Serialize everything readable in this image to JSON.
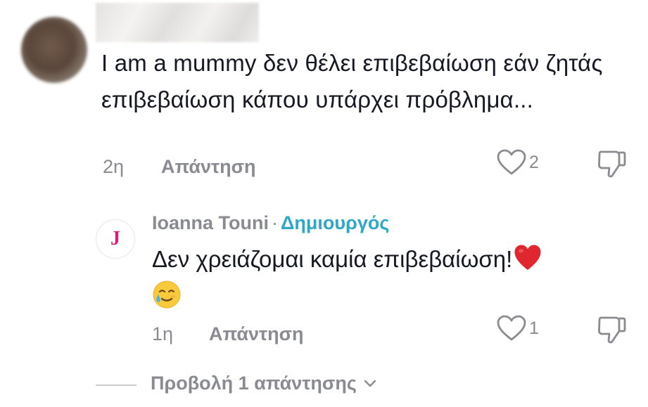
{
  "comment": {
    "text": "I am a mummy δεν θέλει επιβεβαίωση εάν ζητάς επιβεβαίωση κάπου υπάρχει πρόβλημα...",
    "time": "2η",
    "reply_label": "Απάντηση",
    "like_count": "2",
    "icons": {
      "like": "heart-outline-icon",
      "dislike": "thumbs-down-icon"
    }
  },
  "reply": {
    "avatar_letter": "J",
    "author": "Ioanna Touni",
    "separator": "·",
    "badge": "Δημιουργός",
    "text": "Δεν χρειάζομαι καμία επιβεβαίωση!",
    "time": "1η",
    "reply_label": "Απάντηση",
    "like_count": "1",
    "icons": {
      "like": "heart-outline-icon",
      "dislike": "thumbs-down-icon",
      "emoji_1": "red-heart-emoji",
      "emoji_2": "smiling-face-with-tear-emoji"
    }
  },
  "view_replies": {
    "label": "Προβολή 1 απάντησης",
    "icon": "chevron-down-icon"
  },
  "colors": {
    "text_primary": "#161823",
    "text_secondary": "#8a8b91",
    "creator_badge": "#2ea8c7",
    "avatar_letter": "#d61e7a",
    "heart": "#e0262f"
  }
}
